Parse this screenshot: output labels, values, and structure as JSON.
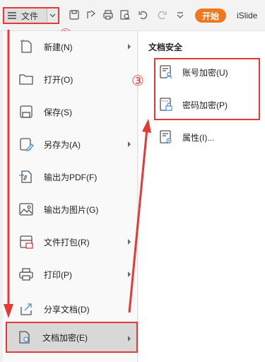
{
  "toolbar": {
    "file_label": "文件",
    "start_label": "开始",
    "islide_label": "iSlide"
  },
  "annotations": [
    "①",
    "②",
    "③"
  ],
  "file_menu": {
    "items": [
      {
        "label": "新建(N)",
        "icon": "new-icon",
        "has_submenu": true
      },
      {
        "label": "打开(O)",
        "icon": "open-folder-icon",
        "has_submenu": false
      },
      {
        "label": "保存(S)",
        "icon": "save-icon",
        "has_submenu": false
      },
      {
        "label": "另存为(A)",
        "icon": "save-as-icon",
        "has_submenu": true
      },
      {
        "label": "输出为PDF(F)",
        "icon": "pdf-icon",
        "has_submenu": false
      },
      {
        "label": "输出为图片(G)",
        "icon": "image-icon",
        "has_submenu": false
      },
      {
        "label": "文件打包(R)",
        "icon": "package-icon",
        "has_submenu": true
      },
      {
        "label": "打印(P)",
        "icon": "print-icon",
        "has_submenu": true
      },
      {
        "label": "分享文档(D)",
        "icon": "share-icon",
        "has_submenu": false
      },
      {
        "label": "文档加密(E)",
        "icon": "encrypt-icon",
        "has_submenu": true,
        "active": true
      }
    ]
  },
  "security_panel": {
    "title": "文档安全",
    "items": [
      {
        "label": "账号加密(U)",
        "icon": "account-lock-icon"
      },
      {
        "label": "密码加密(P)",
        "icon": "password-lock-icon"
      },
      {
        "label": "属性(I)...",
        "icon": "properties-icon"
      }
    ]
  },
  "colors": {
    "annotation_red": "#e53935",
    "accent_orange": "#f0771e",
    "menu_bg": "#f9f9f9",
    "active_bg": "#d8d8d8"
  }
}
